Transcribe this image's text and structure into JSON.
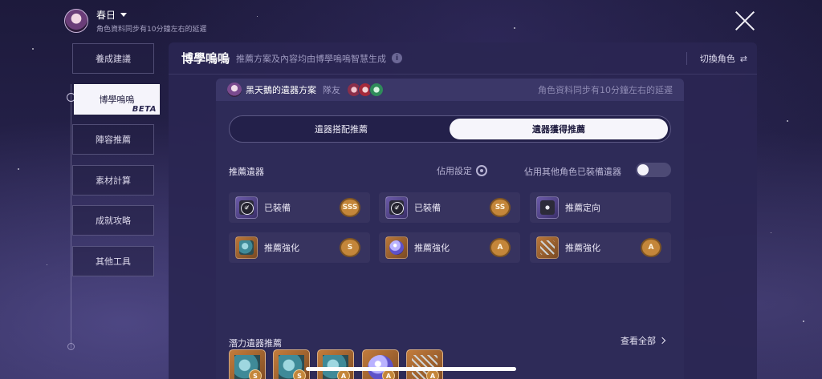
{
  "user": {
    "name": "春日",
    "sync_note": "角色資料同步有10分鐘左右的延遲"
  },
  "sidebar": {
    "items": [
      {
        "label": "養成建議",
        "active": false
      },
      {
        "label": "博學嗚嗚",
        "active": true,
        "badge": "BETA"
      },
      {
        "label": "陣容推薦",
        "active": false
      },
      {
        "label": "素材計算",
        "active": false
      },
      {
        "label": "成就攻略",
        "active": false
      },
      {
        "label": "其他工具",
        "active": false
      }
    ]
  },
  "panel": {
    "title": "博學嗚嗚",
    "subtitle": "推薦方案及內容均由博學嗚嗚智慧生成",
    "info_icon": "i",
    "switch_label": "切換角色",
    "switch_icon": "⇄"
  },
  "card": {
    "scheme_title": "黑天鵝的遺器方案",
    "team_label": "隊友",
    "sync_note": "角色資料同步有10分鐘左右的延遲",
    "tabs": [
      {
        "label": "遺器搭配推薦",
        "selected": false
      },
      {
        "label": "遺器獲得推薦",
        "selected": true
      }
    ],
    "recommended": {
      "title": "推薦遺器",
      "settings_label": "佔用設定",
      "toggle_label": "佔用其他角色已裝備遺器",
      "toggle_on": false,
      "slots": [
        {
          "label": "已裝備",
          "grade": "SSS",
          "equipped": true
        },
        {
          "label": "已裝備",
          "grade": "SS",
          "equipped": true
        },
        {
          "label": "推薦定向",
          "grade": "",
          "equipped": false
        },
        {
          "label": "推薦強化",
          "grade": "S",
          "equipped": false
        },
        {
          "label": "推薦強化",
          "grade": "A",
          "equipped": false
        },
        {
          "label": "推薦強化",
          "grade": "A",
          "equipped": false
        }
      ]
    },
    "potential": {
      "title": "潛力遺器推薦",
      "view_all": "查看全部",
      "items": [
        {
          "grade": "S"
        },
        {
          "grade": "S"
        },
        {
          "grade": "A"
        },
        {
          "grade": "A"
        },
        {
          "grade": "A"
        }
      ]
    }
  },
  "colors": {
    "accent_grade": "#c4863a",
    "panel_bg": "#2a2652",
    "active_tab": "#f6f5fb"
  }
}
